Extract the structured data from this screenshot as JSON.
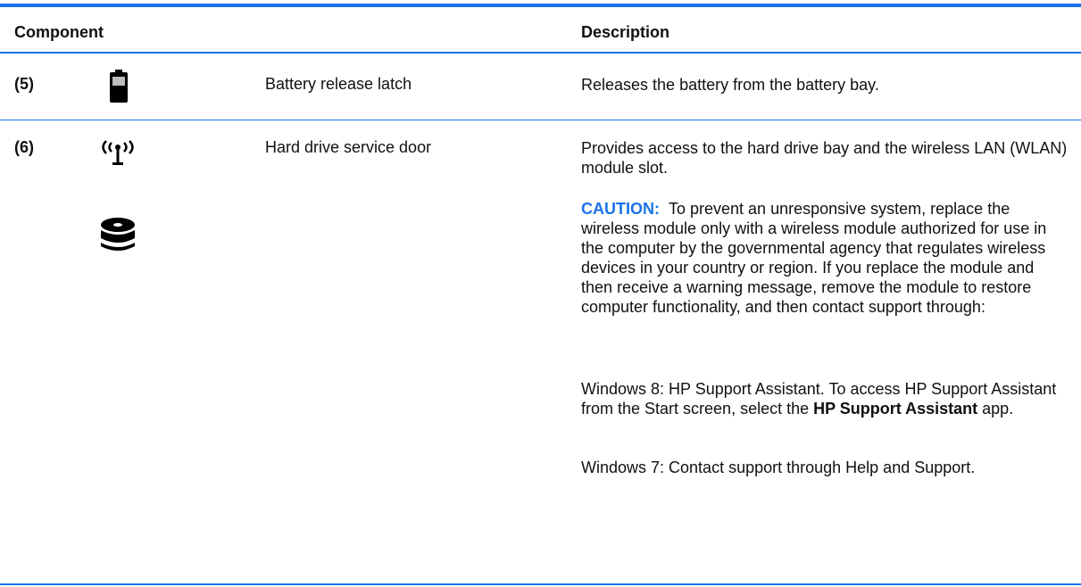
{
  "table": {
    "headers": {
      "component": "Component",
      "description": "Description"
    },
    "rows": [
      {
        "number": "(5)",
        "icon": "battery-icon",
        "component": "Battery release latch",
        "description": "Releases the battery from the battery bay."
      },
      {
        "number": "(6)",
        "icons": [
          "wireless-icon",
          "hard-drive-icon"
        ],
        "component": "Hard drive service door",
        "description": "Provides access to the hard drive bay and the wireless LAN (WLAN) module slot.",
        "caution_label": "CAUTION:",
        "caution_text": "To prevent an unresponsive system, replace the wireless module only with a wireless module authorized for use in the computer by the governmental agency that regulates wireless devices in your country or region. If you replace the module and then receive a warning message, remove the module to restore computer functionality, and then contact support through:",
        "win8_before": "Windows 8: HP Support Assistant. To access HP Support Assistant from the Start screen, select the ",
        "win8_bold": "HP Support Assistant",
        "win8_after": " app.",
        "win7": "Windows 7: Contact support through Help and Support."
      }
    ]
  },
  "colors": {
    "accent": "#1a73e8",
    "text": "#111111"
  }
}
